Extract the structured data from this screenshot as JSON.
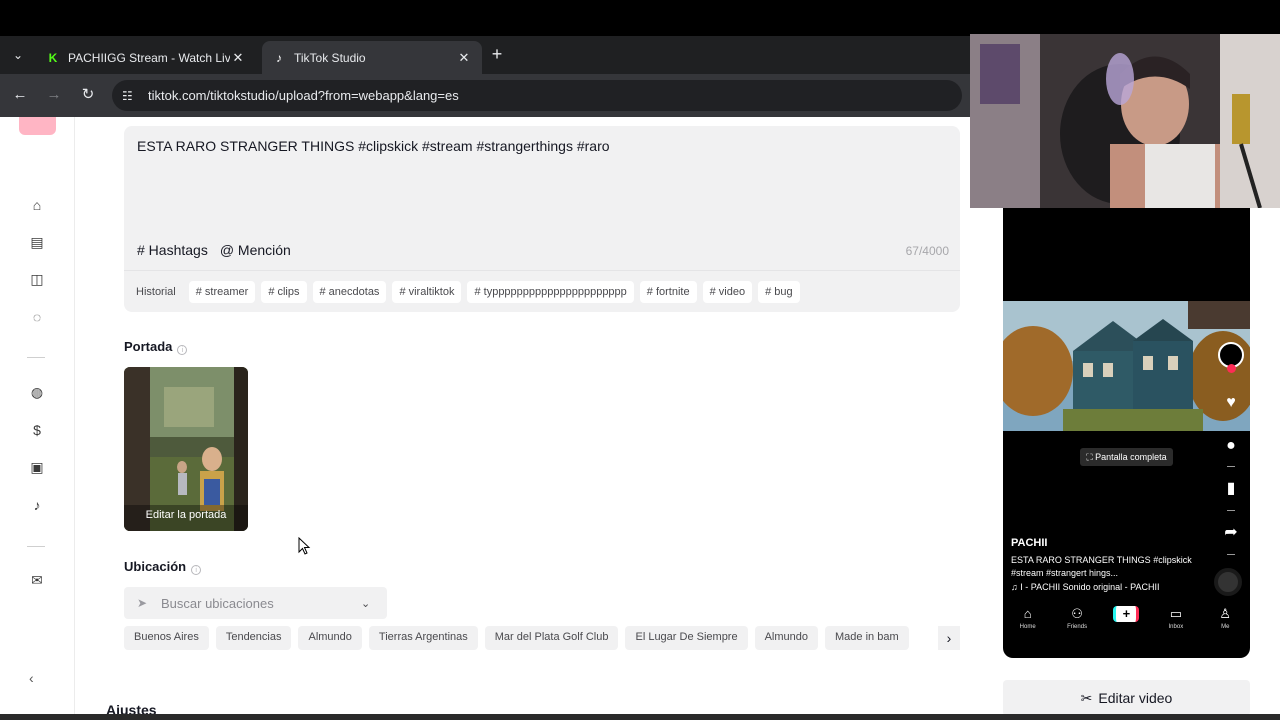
{
  "browser": {
    "tabs": [
      {
        "title": "PACHIIGG Stream - Watch Live",
        "favicon": "kick-icon"
      },
      {
        "title": "TikTok Studio",
        "favicon": "tiktok-icon"
      }
    ],
    "url": "tiktok.com/tiktokstudio/upload?from=webapp&lang=es"
  },
  "description": {
    "text_plain": "ESTA RARO STRANGER THINGS ",
    "hashtags": "#clipskick #stream #strangerthings #raro",
    "hashtags_label": "# Hashtags",
    "mention_label": "@ Mención",
    "counter": "67/4000",
    "history_label": "Historial",
    "suggested_tags": [
      "# streamer",
      "# clips",
      "# anecdotas",
      "# viraltiktok",
      "# typppppppppppppppppppppp",
      "# fortnite",
      "# video",
      "# bug"
    ]
  },
  "cover": {
    "label": "Portada",
    "edit_label": "Editar la portada"
  },
  "location": {
    "label": "Ubicación",
    "placeholder": "Buscar ubicaciones",
    "suggestions": [
      "Buenos Aires",
      "Tendencias",
      "Almundo",
      "Tierras Argentinas",
      "Mar del Plata Golf Club",
      "El Lugar De Siempre",
      "Almundo",
      "Made in bam"
    ]
  },
  "next_section": "Ajustes",
  "preview": {
    "fullscreen_label": "Pantalla completa",
    "username": "PACHII",
    "caption": "ESTA RARO STRANGER THINGS #clipskick #stream #strangert hings...",
    "sound": "♫ I - PACHII     Sonido original - PACHII",
    "nav": [
      {
        "label": "Home",
        "icon": "home-icon"
      },
      {
        "label": "Friends",
        "icon": "friends-icon"
      },
      {
        "label": "",
        "icon": "create-icon"
      },
      {
        "label": "Inbox",
        "icon": "inbox-icon"
      },
      {
        "label": "Me",
        "icon": "profile-icon"
      }
    ]
  },
  "edit_video_label": "Editar video",
  "colors": {
    "accent": "#fe2c55",
    "panel_bg": "#f1f1f2",
    "text": "#161823"
  }
}
